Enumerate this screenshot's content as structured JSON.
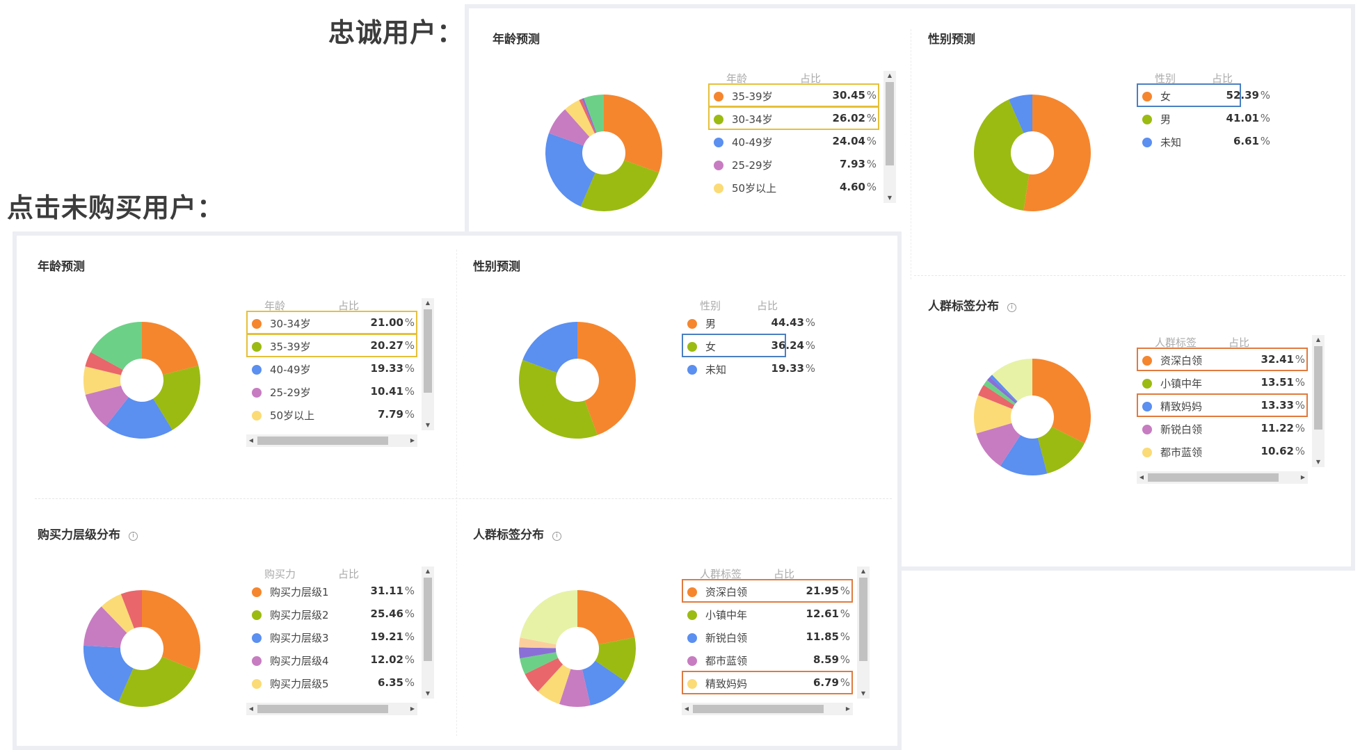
{
  "headings": {
    "loyal": "忠诚用户：",
    "not_purchased": "点击未购买用户："
  },
  "loyal": {
    "age": {
      "title": "年龄预测",
      "col_name": "年龄",
      "col_pct": "占比",
      "rows": [
        {
          "name": "35-39岁",
          "value": "30.45",
          "color": "#f5862e"
        },
        {
          "name": "30-34岁",
          "value": "26.02",
          "color": "#9bbb13"
        },
        {
          "name": "40-49岁",
          "value": "24.04",
          "color": "#5b8ff0"
        },
        {
          "name": "25-29岁",
          "value": "7.93",
          "color": "#c77cc1"
        },
        {
          "name": "50岁以上",
          "value": "4.60",
          "color": "#fbdb76"
        }
      ],
      "highlight_color": "#e5c03a"
    },
    "gender": {
      "title": "性别预测",
      "col_name": "性别",
      "col_pct": "占比",
      "rows": [
        {
          "name": "女",
          "value": "52.39",
          "color": "#f5862e"
        },
        {
          "name": "男",
          "value": "41.01",
          "color": "#9bbb13"
        },
        {
          "name": "未知",
          "value": "6.61",
          "color": "#5b8ff0"
        }
      ],
      "highlight_color": "#4a7fc1"
    },
    "crowd": {
      "title": "人群标签分布",
      "info": "i",
      "col_name": "人群标签",
      "col_pct": "占比",
      "rows": [
        {
          "name": "资深白领",
          "value": "32.41",
          "color": "#f5862e"
        },
        {
          "name": "小镇中年",
          "value": "13.51",
          "color": "#9bbb13"
        },
        {
          "name": "精致妈妈",
          "value": "13.33",
          "color": "#5b8ff0"
        },
        {
          "name": "新锐白领",
          "value": "11.22",
          "color": "#c77cc1"
        },
        {
          "name": "都市蓝领",
          "value": "10.62",
          "color": "#fbdb76"
        }
      ],
      "highlight_color": "#e07a3e"
    }
  },
  "not_purchased": {
    "age": {
      "title": "年龄预测",
      "col_name": "年龄",
      "col_pct": "占比",
      "rows": [
        {
          "name": "30-34岁",
          "value": "21.00",
          "color": "#f5862e"
        },
        {
          "name": "35-39岁",
          "value": "20.27",
          "color": "#9bbb13"
        },
        {
          "name": "40-49岁",
          "value": "19.33",
          "color": "#5b8ff0"
        },
        {
          "name": "25-29岁",
          "value": "10.41",
          "color": "#c77cc1"
        },
        {
          "name": "50岁以上",
          "value": "7.79",
          "color": "#fbdb76"
        }
      ],
      "highlight_color": "#e5c03a"
    },
    "gender": {
      "title": "性别预测",
      "col_name": "性别",
      "col_pct": "占比",
      "rows": [
        {
          "name": "男",
          "value": "44.43",
          "color": "#f5862e"
        },
        {
          "name": "女",
          "value": "36.24",
          "color": "#9bbb13"
        },
        {
          "name": "未知",
          "value": "19.33",
          "color": "#5b8ff0"
        }
      ],
      "highlight_color": "#4a7fc1"
    },
    "purchase": {
      "title": "购买力层级分布",
      "info": "i",
      "col_name": "购买力",
      "col_pct": "占比",
      "rows": [
        {
          "name": "购买力层级1",
          "value": "31.11",
          "color": "#f5862e"
        },
        {
          "name": "购买力层级2",
          "value": "25.46",
          "color": "#9bbb13"
        },
        {
          "name": "购买力层级3",
          "value": "19.21",
          "color": "#5b8ff0"
        },
        {
          "name": "购买力层级4",
          "value": "12.02",
          "color": "#c77cc1"
        },
        {
          "name": "购买力层级5",
          "value": "6.35",
          "color": "#fbdb76"
        }
      ]
    },
    "crowd": {
      "title": "人群标签分布",
      "info": "i",
      "col_name": "人群标签",
      "col_pct": "占比",
      "rows": [
        {
          "name": "资深白领",
          "value": "21.95",
          "color": "#f5862e"
        },
        {
          "name": "小镇中年",
          "value": "12.61",
          "color": "#9bbb13"
        },
        {
          "name": "新锐白领",
          "value": "11.85",
          "color": "#5b8ff0"
        },
        {
          "name": "都市蓝领",
          "value": "8.59",
          "color": "#c77cc1"
        },
        {
          "name": "精致妈妈",
          "value": "6.79",
          "color": "#fbdb76"
        }
      ],
      "highlight_color": "#e07a3e"
    }
  },
  "percent_sign": "%",
  "chart_data": [
    {
      "id": "loyal_age",
      "type": "pie",
      "title": "年龄预测",
      "categories": [
        "35-39岁",
        "30-34岁",
        "40-49岁",
        "25-29岁",
        "50岁以上",
        "unlabeled-1",
        "unlabeled-2",
        "unlabeled-3"
      ],
      "values": [
        30.45,
        26.02,
        24.04,
        7.93,
        4.6,
        0.8,
        0.6,
        5.56
      ],
      "colors": [
        "#f5862e",
        "#9bbb13",
        "#5b8ff0",
        "#c77cc1",
        "#fbdb76",
        "#e9666a",
        "#8a6fd6",
        "#6dd087"
      ]
    },
    {
      "id": "loyal_gender",
      "type": "pie",
      "title": "性别预测",
      "categories": [
        "女",
        "男",
        "未知"
      ],
      "values": [
        52.39,
        41.01,
        6.61
      ],
      "colors": [
        "#f5862e",
        "#9bbb13",
        "#5b8ff0"
      ]
    },
    {
      "id": "loyal_crowd",
      "type": "pie",
      "title": "人群标签分布",
      "categories": [
        "资深白领",
        "小镇中年",
        "精致妈妈",
        "新锐白领",
        "都市蓝领",
        "unlabeled-1",
        "unlabeled-2",
        "unlabeled-3",
        "unlabeled-4",
        "unlabeled-5"
      ],
      "values": [
        32.41,
        13.51,
        13.33,
        11.22,
        10.62,
        3.2,
        1.6,
        1.2,
        0.8,
        12.11
      ],
      "colors": [
        "#f5862e",
        "#9bbb13",
        "#5b8ff0",
        "#c77cc1",
        "#fbdb76",
        "#e9666a",
        "#6dd087",
        "#8a6fd6",
        "#5b8ff0",
        "#e7f2a6"
      ]
    },
    {
      "id": "np_age",
      "type": "pie",
      "title": "年龄预测",
      "categories": [
        "30-34岁",
        "35-39岁",
        "40-49岁",
        "25-29岁",
        "50岁以上",
        "unlabeled-1",
        "unlabeled-2"
      ],
      "values": [
        21.0,
        20.27,
        19.33,
        10.41,
        7.79,
        4.2,
        17.0
      ],
      "colors": [
        "#f5862e",
        "#9bbb13",
        "#5b8ff0",
        "#c77cc1",
        "#fbdb76",
        "#e9666a",
        "#6dd087"
      ]
    },
    {
      "id": "np_gender",
      "type": "pie",
      "title": "性别预测",
      "categories": [
        "男",
        "女",
        "未知"
      ],
      "values": [
        44.43,
        36.24,
        19.33
      ],
      "colors": [
        "#f5862e",
        "#9bbb13",
        "#5b8ff0"
      ]
    },
    {
      "id": "np_purchase",
      "type": "pie",
      "title": "购买力层级分布",
      "categories": [
        "购买力层级1",
        "购买力层级2",
        "购买力层级3",
        "购买力层级4",
        "购买力层级5",
        "unlabeled-1"
      ],
      "values": [
        31.11,
        25.46,
        19.21,
        12.02,
        6.35,
        5.85
      ],
      "colors": [
        "#f5862e",
        "#9bbb13",
        "#5b8ff0",
        "#c77cc1",
        "#fbdb76",
        "#e9666a"
      ]
    },
    {
      "id": "np_crowd",
      "type": "pie",
      "title": "人群标签分布",
      "categories": [
        "资深白领",
        "小镇中年",
        "新锐白领",
        "都市蓝领",
        "精致妈妈",
        "unlabeled-1",
        "unlabeled-2",
        "unlabeled-3",
        "unlabeled-4",
        "unlabeled-5"
      ],
      "values": [
        21.95,
        12.61,
        11.85,
        8.59,
        6.79,
        6.0,
        4.5,
        3.0,
        2.7,
        22.0
      ],
      "colors": [
        "#f5862e",
        "#9bbb13",
        "#5b8ff0",
        "#c77cc1",
        "#fbdb76",
        "#e9666a",
        "#6dd087",
        "#8a6fd6",
        "#fbcf9d",
        "#e7f2a6"
      ]
    }
  ]
}
